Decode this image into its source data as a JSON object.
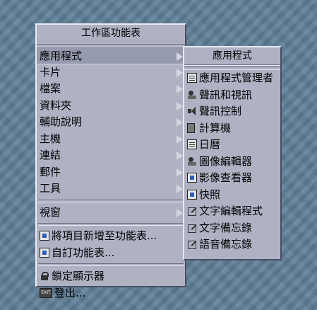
{
  "workspace_menu": {
    "title": "工作區功能表",
    "items": [
      {
        "label": "應用程式",
        "submenu": true,
        "selected": true
      },
      {
        "label": "卡片",
        "submenu": true
      },
      {
        "label": "檔案",
        "submenu": true
      },
      {
        "label": "資料夾",
        "submenu": true
      },
      {
        "label": "輔助說明",
        "submenu": true
      },
      {
        "label": "主機",
        "submenu": true
      },
      {
        "label": "連結",
        "submenu": true
      },
      {
        "label": "郵件",
        "submenu": true
      },
      {
        "label": "工具",
        "submenu": true
      }
    ],
    "view_label": "視窗",
    "add_item_label": "將項目新增至功能表...",
    "customize_label": "自訂功能表...",
    "lock_label": "鎖定顯示器",
    "logout_label": "登出...",
    "exit_icon_text": "EXIT"
  },
  "apps_submenu": {
    "title": "應用程式",
    "items": [
      {
        "label": "應用程式管理者",
        "icon": "app-manager-icon"
      },
      {
        "label": "聲訊和視訊",
        "icon": "audio-video-icon"
      },
      {
        "label": "聲訊控制",
        "icon": "audio-control-icon"
      },
      {
        "label": "計算機",
        "icon": "calculator-icon"
      },
      {
        "label": "日曆",
        "icon": "calendar-icon"
      },
      {
        "label": "圖像編輯器",
        "icon": "image-editor-icon"
      },
      {
        "label": "影像查看器",
        "icon": "image-viewer-icon"
      },
      {
        "label": "快照",
        "icon": "snapshot-icon"
      },
      {
        "label": "文字編輯程式",
        "icon": "text-editor-icon"
      },
      {
        "label": "文字備忘錄",
        "icon": "text-note-icon"
      },
      {
        "label": "語音備忘錄",
        "icon": "voice-note-icon"
      }
    ]
  },
  "colors": {
    "desktop": "#5f7e96",
    "menu_bg": "#aeb2c3",
    "selected_bg": "#959aae"
  }
}
